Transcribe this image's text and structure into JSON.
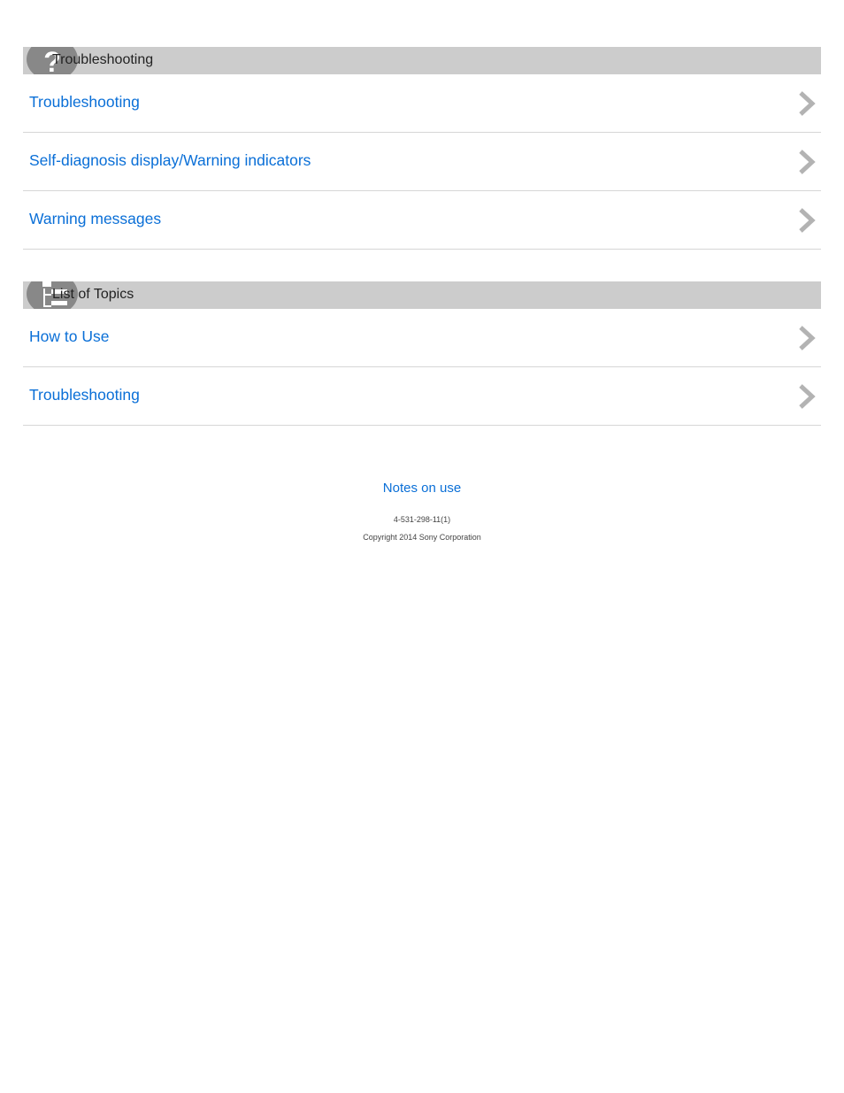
{
  "sections": [
    {
      "title": "Troubleshooting",
      "icon": "question-icon",
      "items": [
        {
          "label": "Troubleshooting"
        },
        {
          "label": "Self-diagnosis display/Warning indicators"
        },
        {
          "label": "Warning messages"
        }
      ]
    },
    {
      "title": "List of Topics",
      "icon": "list-topics-icon",
      "items": [
        {
          "label": "How to Use"
        },
        {
          "label": "Troubleshooting"
        }
      ]
    }
  ],
  "footer": {
    "notes_link": "Notes on use",
    "doc_number": "4-531-298-11(1)",
    "copyright": "Copyright 2014 Sony Corporation"
  },
  "colors": {
    "link": "#0a6fd7",
    "header_bg": "#cccccc",
    "icon_circle": "#888888",
    "chevron": "#b3b3b3"
  }
}
